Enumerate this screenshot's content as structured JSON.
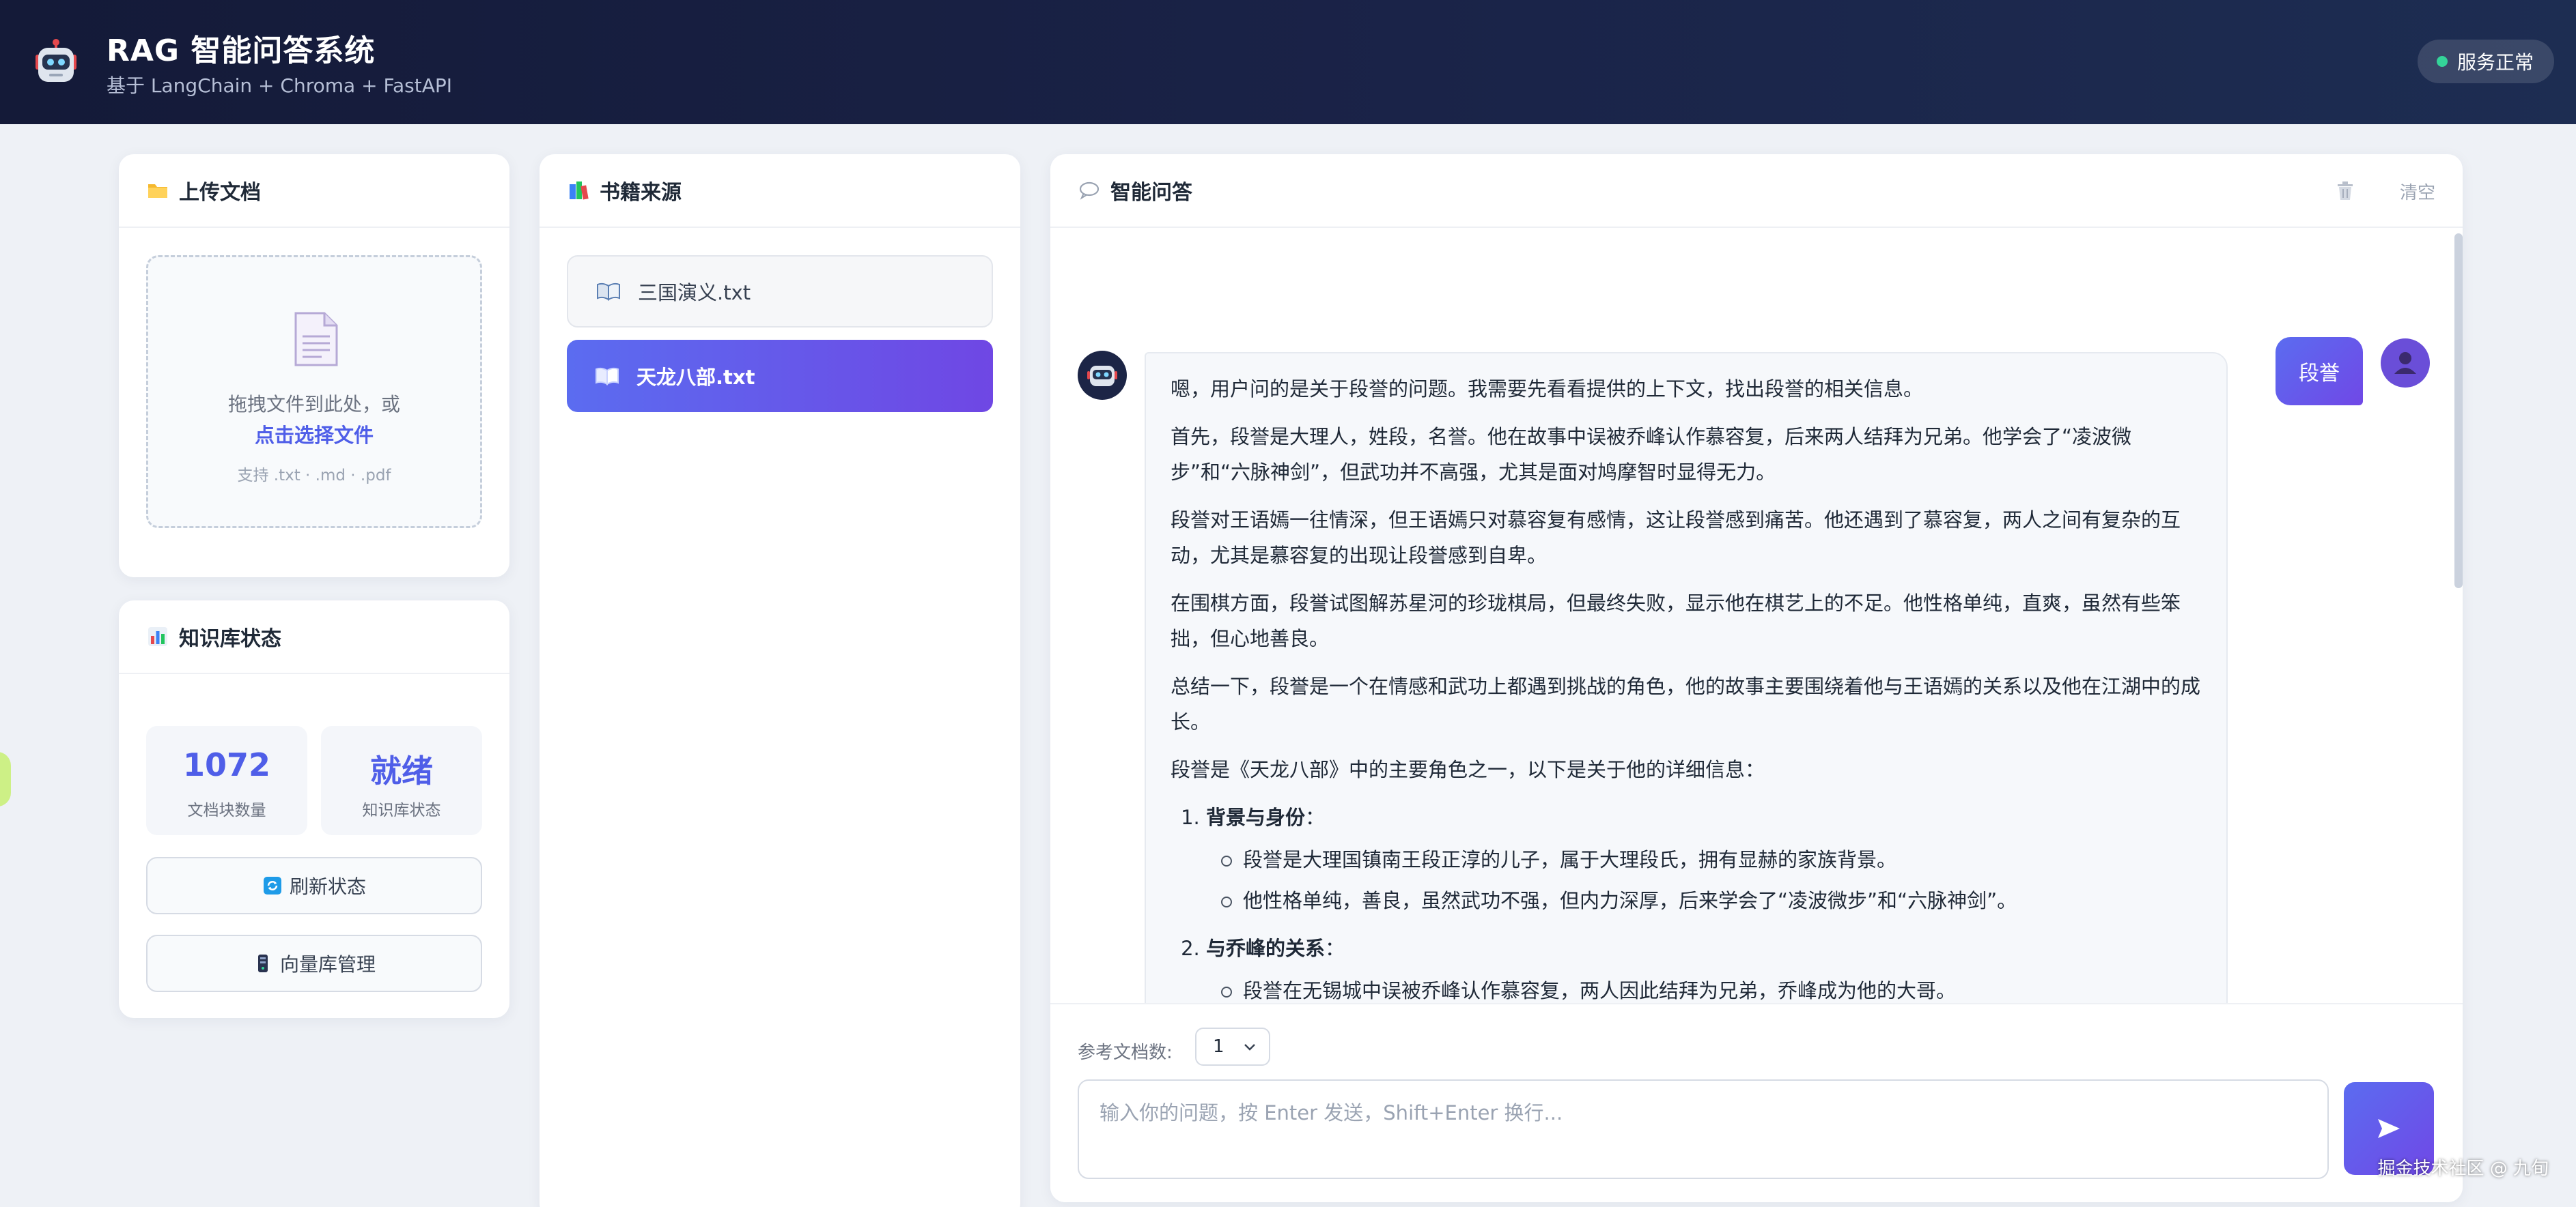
{
  "header": {
    "title": "RAG 智能问答系统",
    "subtitle": "基于 LangChain + Chroma + FastAPI",
    "status": "服务正常",
    "status_color": "#34d399"
  },
  "upload": {
    "title": "上传文档",
    "title_icon": "folder-icon",
    "drop_text": "拖拽文件到此处，或",
    "select_link": "点击选择文件",
    "hint": "支持 .txt · .md · .pdf"
  },
  "kb": {
    "title": "知识库状态",
    "title_icon": "bar-chart-icon",
    "chunks_value": "1072",
    "chunks_label": "文档块数量",
    "state_value": "就绪",
    "state_label": "知识库状态",
    "refresh_label": "刷新状态",
    "manage_label": "向量库管理"
  },
  "books": {
    "title": "书籍来源",
    "title_icon": "books-icon",
    "items": [
      {
        "label": "三国演义.txt",
        "selected": false
      },
      {
        "label": "天龙八部.txt",
        "selected": true
      }
    ]
  },
  "chat": {
    "title": "智能问答",
    "title_icon": "speech-bubble-icon",
    "clear_label": "清空",
    "user_message": "段誉",
    "answer": {
      "p1": "嗯，用户问的是关于段誉的问题。我需要先看看提供的上下文，找出段誉的相关信息。",
      "p2": "首先，段誉是大理人，姓段，名誉。他在故事中误被乔峰认作慕容复，后来两人结拜为兄弟。他学会了“凌波微步”和“六脉神剑”，但武功并不高强，尤其是面对鸠摩智时显得无力。",
      "p3": "段誉对王语嫣一往情深，但王语嫣只对慕容复有感情，这让段誉感到痛苦。他还遇到了慕容复，两人之间有复杂的互动，尤其是慕容复的出现让段誉感到自卑。",
      "p4": "在围棋方面，段誉试图解苏星河的珍珑棋局，但最终失败，显示他在棋艺上的不足。他性格单纯，直爽，虽然有些笨拙，但心地善良。",
      "p5": "总结一下，段誉是一个在情感和武功上都遇到挑战的角色，他的故事主要围绕着他与王语嫣的关系以及他在江湖中的成长。",
      "p6": "段誉是《天龙八部》中的主要角色之一，以下是关于他的详细信息：",
      "section1_title": "背景与身份",
      "section1_b1": "段誉是大理国镇南王段正淳的儿子，属于大理段氏，拥有显赫的家族背景。",
      "section1_b2": "他性格单纯，善良，虽然武功不强，但内力深厚，后来学会了“凌波微步”和“六脉神剑”。",
      "section2_title": "与乔峰的关系",
      "section2_b1": "段誉在无锡城中误被乔峰认作慕容复，两人因此结拜为兄弟，乔峰成为他的大哥。",
      "colon": "："
    },
    "ref_label": "参考文档数:",
    "ref_value": "1",
    "input_placeholder": "输入你的问题，按 Enter 发送，Shift+Enter 换行..."
  },
  "watermark": "掘金技术社区 @ 九旬",
  "colors": {
    "accent": "#4f5ee8",
    "accent_gradient_end": "#7048e6",
    "header_bg": "#141a38"
  }
}
